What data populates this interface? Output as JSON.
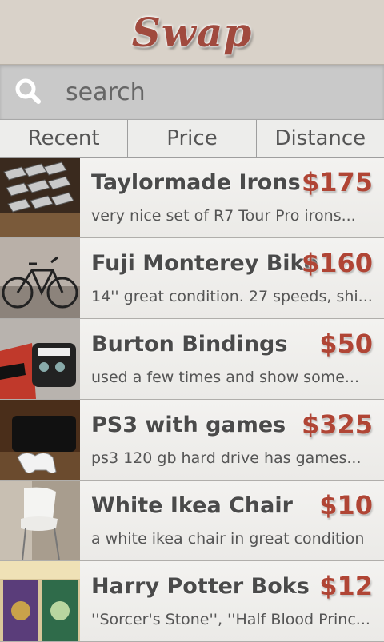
{
  "app": {
    "title": "Swap"
  },
  "search": {
    "placeholder": "search",
    "value": ""
  },
  "sort_tabs": [
    {
      "label": "Recent"
    },
    {
      "label": "Price"
    },
    {
      "label": "Distance"
    }
  ],
  "listings": [
    {
      "title": "Taylormade Irons",
      "price": "$175",
      "description": "very nice set of R7 Tour Pro irons..."
    },
    {
      "title": "Fuji Monterey Bike",
      "price": "$160",
      "description": "14'' great condition. 27 speeds, shi..."
    },
    {
      "title": "Burton Bindings",
      "price": "$50",
      "description": "used a few times and show some..."
    },
    {
      "title": "PS3 with games",
      "price": "$325",
      "description": "ps3 120 gb hard drive has games..."
    },
    {
      "title": "White Ikea Chair",
      "price": "$10",
      "description": "a white ikea chair in great condition"
    },
    {
      "title": "Harry Potter Boks",
      "price": "$12",
      "description": "''Sorcer's Stone'', ''Half Blood Princ..."
    }
  ],
  "colors": {
    "accent": "#b04535",
    "header_bg": "#d9d2c9",
    "search_bg": "#c9c9c9"
  },
  "icons": {
    "search": "search-icon"
  }
}
